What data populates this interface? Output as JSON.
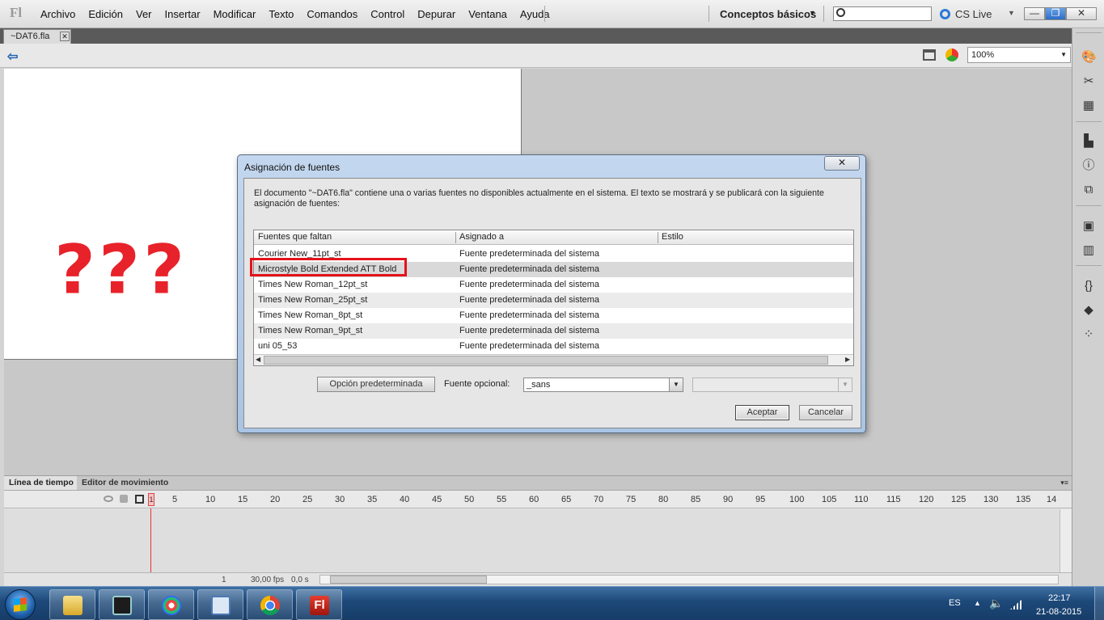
{
  "app": {
    "logo": "Fl",
    "menu": [
      "Archivo",
      "Edición",
      "Ver",
      "Insertar",
      "Modificar",
      "Texto",
      "Comandos",
      "Control",
      "Depurar",
      "Ventana",
      "Ayuda"
    ],
    "workspace": "Conceptos básicos",
    "search_placeholder": "",
    "cs_live": "CS Live",
    "window_buttons": {
      "minimize": "—",
      "restore": "❐",
      "close": "✕"
    }
  },
  "document": {
    "tab_title": "~DAT6.fla",
    "tab_close": "✕",
    "zoom": "100%"
  },
  "stage": {
    "text": "???",
    "text_color": "#e8222a"
  },
  "dialog": {
    "title": "Asignación de fuentes",
    "close": "✕",
    "message": "El documento \"~DAT6.fla\" contiene una o varias fuentes no disponibles actualmente en el sistema. El texto se mostrará y se publicará con la siguiente asignación de fuentes:",
    "columns": [
      "Fuentes que faltan",
      "Asignado a",
      "Estilo"
    ],
    "rows": [
      {
        "font": "Courier New_11pt_st",
        "assigned": "Fuente predeterminada del sistema"
      },
      {
        "font": "Microstyle Bold Extended ATT Bold",
        "assigned": "Fuente predeterminada del sistema"
      },
      {
        "font": "Times New Roman_12pt_st",
        "assigned": "Fuente predeterminada del sistema"
      },
      {
        "font": "Times New Roman_25pt_st",
        "assigned": "Fuente predeterminada del sistema"
      },
      {
        "font": "Times New Roman_8pt_st",
        "assigned": "Fuente predeterminada del sistema"
      },
      {
        "font": "Times New Roman_9pt_st",
        "assigned": "Fuente predeterminada del sistema"
      },
      {
        "font": "uni 05_53",
        "assigned": "Fuente predeterminada del sistema"
      }
    ],
    "highlight_color": "#e5121a",
    "default_button": "Opción predeterminada",
    "optional_font_label": "Fuente opcional:",
    "optional_font_value": "_sans",
    "accept": "Aceptar",
    "cancel": "Cancelar"
  },
  "timeline": {
    "tabs": [
      "Línea de tiempo",
      "Editor de movimiento"
    ],
    "frame_numbers": [
      "1",
      "5",
      "10",
      "15",
      "20",
      "25",
      "30",
      "35",
      "40",
      "45",
      "50",
      "55",
      "60",
      "65",
      "70",
      "75",
      "80",
      "85",
      "90",
      "95",
      "100",
      "105",
      "110",
      "115",
      "120",
      "125",
      "130",
      "135",
      "14"
    ],
    "current_frame": "1",
    "fps": "30,00 fps",
    "time": "0,0 s"
  },
  "taskbar": {
    "apps": [
      "explorer-icon",
      "task-manager-icon",
      "paint-icon",
      "remote-desktop-icon",
      "chrome-icon",
      "flash-icon"
    ],
    "flash_label": "Fl",
    "language": "ES",
    "time": "22:17",
    "date": "21-08-2015"
  }
}
